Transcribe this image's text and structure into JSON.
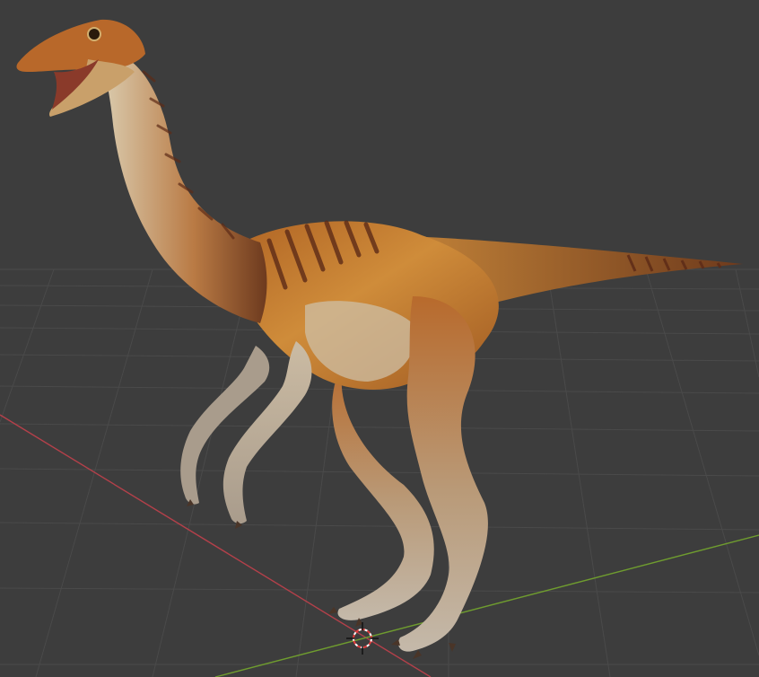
{
  "viewport": {
    "background": "#3d3d3d",
    "grid_color": "#4a4a4a",
    "x_axis_color": "#b3404a",
    "y_axis_color": "#6f9c2f",
    "cursor_colors": [
      "#e23b3b",
      "#ffffff"
    ]
  },
  "model": {
    "icon": "dinosaur-model",
    "colors": {
      "body": "#c27b2c",
      "stripe": "#5d2b17",
      "belly": "#cdbfa6",
      "limb": "#b8ab9a",
      "claw": "#4a3528"
    }
  }
}
